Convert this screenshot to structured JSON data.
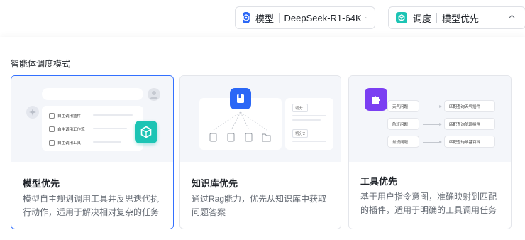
{
  "topbar": {
    "model_selector": {
      "label": "模型",
      "value": "DeepSeek-R1-64K",
      "icon": "model-cube-icon",
      "color": "#2b67f6"
    },
    "schedule_selector": {
      "label": "调度",
      "value": "模型优先",
      "icon": "schedule-cube-icon",
      "color": "#1cc4b4"
    }
  },
  "panel": {
    "section_title": "智能体调度模式",
    "cards": [
      {
        "title": "模型优先",
        "description": "模型自主规划调用工具并反思迭代执行动作，适用于解决相对复杂的任务",
        "selected": true,
        "accent": "#1cc4b4",
        "illustration": {
          "rows": [
            "自主调用插件",
            "自主调用工作流",
            "自主调用工具"
          ]
        }
      },
      {
        "title": "知识库优先",
        "description": "通过Rag能力，优先从知识库中获取问题答案",
        "selected": false,
        "accent": "#2b67f6",
        "illustration": {
          "tags": [
            "切分1",
            "切分2"
          ]
        }
      },
      {
        "title": "工具优先",
        "description": "基于用户指令意图，准确映射到匹配的插件，适用于明确的工具调用任务",
        "selected": false,
        "accent": "#7b3ff2",
        "illustration": {
          "questions": [
            "天气问题",
            "航班问题",
            "常规问题"
          ],
          "matches": [
            "匹配查询天气插件",
            "匹配查询航班插件",
            "匹配查询维基百科"
          ]
        }
      }
    ]
  }
}
